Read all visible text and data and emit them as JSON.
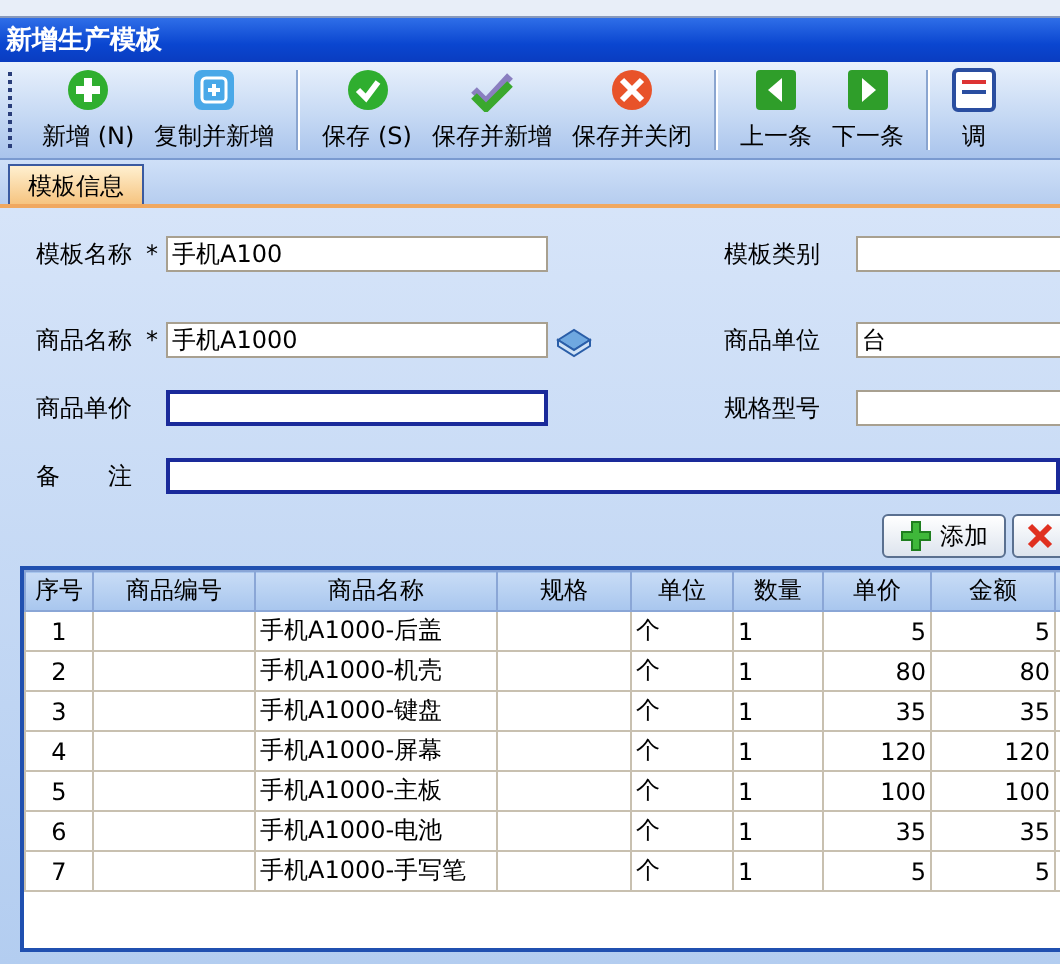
{
  "window": {
    "title": "新增生产模板"
  },
  "toolbar": [
    {
      "kind": "add",
      "label": "新增 (N)"
    },
    {
      "kind": "copy",
      "label": "复制并新增"
    },
    {
      "kind": "separator"
    },
    {
      "kind": "save",
      "label": "保存 (S)"
    },
    {
      "kind": "save-new",
      "label": "保存并新增"
    },
    {
      "kind": "save-close",
      "label": "保存并关闭"
    },
    {
      "kind": "separator"
    },
    {
      "kind": "prev",
      "label": "上一条"
    },
    {
      "kind": "next",
      "label": "下一条"
    },
    {
      "kind": "separator"
    },
    {
      "kind": "adjust",
      "label": "调"
    }
  ],
  "tabs": [
    {
      "label": "模板信息",
      "selected": true
    }
  ],
  "form": {
    "rows": [
      [
        {
          "label": "模板名称",
          "marker": "*",
          "value": "手机A100",
          "active": false
        },
        {
          "label": "模板类别",
          "active": false
        }
      ],
      [
        {
          "label": "商品名称",
          "marker": "*",
          "value": "手机A1000",
          "active": false,
          "lookup": true
        },
        {
          "label": "商品单位",
          "value": "台",
          "active": false
        }
      ],
      [
        {
          "label": "商品单价",
          "active": true
        },
        {
          "label": "规格型号",
          "active": false
        }
      ],
      [
        {
          "label": "备　　注",
          "active": true
        }
      ]
    ]
  },
  "grid_buttons": [
    {
      "kind": "add",
      "label": "添加"
    },
    {
      "kind": "delete"
    }
  ],
  "table": {
    "columns": [
      "序号",
      "商品编号",
      "商品名称",
      "规格",
      "单位",
      "数量",
      "单价",
      "金额"
    ],
    "rows": [
      [
        "1",
        "",
        "手机A1000-后盖",
        "",
        "个",
        "1",
        "5",
        "5"
      ],
      [
        "2",
        "",
        "手机A1000-机壳",
        "",
        "个",
        "1",
        "80",
        "80"
      ],
      [
        "3",
        "",
        "手机A1000-键盘",
        "",
        "个",
        "1",
        "35",
        "35"
      ],
      [
        "4",
        "",
        "手机A1000-屏幕",
        "",
        "个",
        "1",
        "120",
        "120"
      ],
      [
        "5",
        "",
        "手机A1000-主板",
        "",
        "个",
        "1",
        "100",
        "100"
      ],
      [
        "6",
        "",
        "手机A1000-电池",
        "",
        "个",
        "1",
        "35",
        "35"
      ],
      [
        "7",
        "",
        "手机A1000-手写笔",
        "",
        "个",
        "1",
        "5",
        "5"
      ]
    ]
  }
}
